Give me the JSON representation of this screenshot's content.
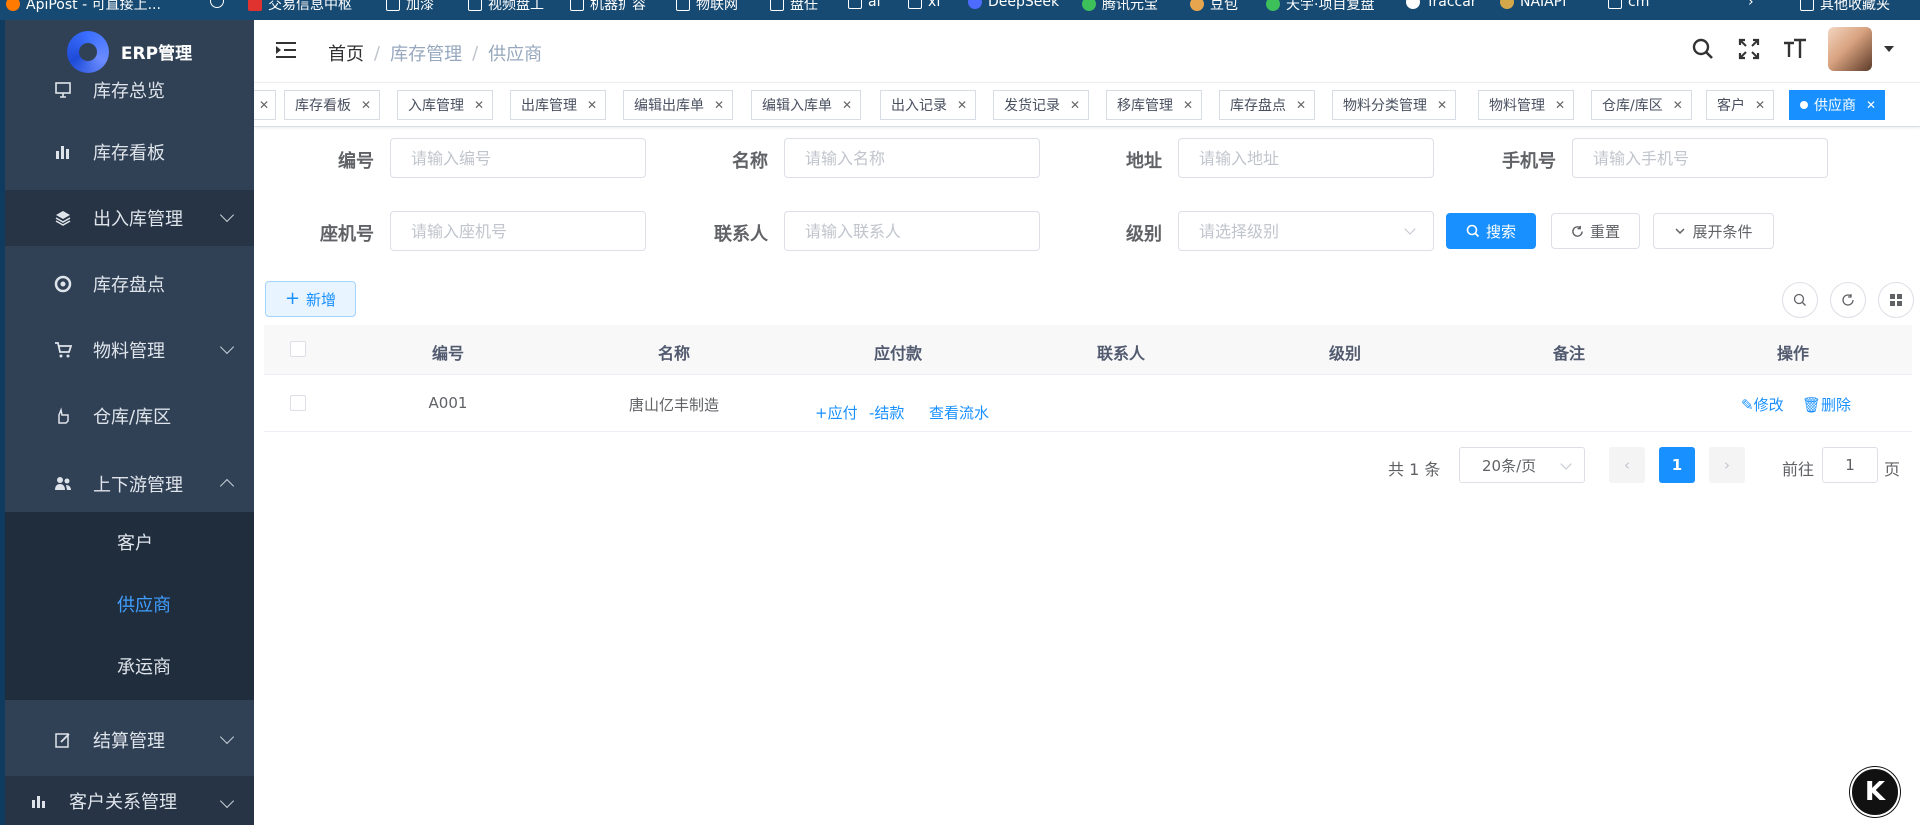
{
  "browser": {
    "bookmarks": [
      {
        "label": "ApiPost - 可直接上...",
        "color": "#ff7a00"
      },
      {
        "label": "",
        "color": "#ffffff"
      },
      {
        "label": "交易信息中枢",
        "color": "#e0322f"
      },
      {
        "label": "加漆",
        "color": "#ffffff"
      },
      {
        "label": "视频盘工",
        "color": "#ffffff"
      },
      {
        "label": "机器扩容",
        "color": "#ffffff"
      },
      {
        "label": "物联网",
        "color": "#ffffff"
      },
      {
        "label": "盘任",
        "color": "#ffffff"
      },
      {
        "label": "ai",
        "color": "#ffffff"
      },
      {
        "label": "xf",
        "color": "#ffffff"
      },
      {
        "label": "DeepSeek",
        "color": "#4d6bfe"
      },
      {
        "label": "腾讯元宝",
        "color": "#3dbf5a"
      },
      {
        "label": "豆包",
        "color": "#e7a64e"
      },
      {
        "label": "天宇·项目复盘",
        "color": "#3dbf5a"
      },
      {
        "label": "Traccar",
        "color": "#ffffff"
      },
      {
        "label": "NAIAPI",
        "color": "#d4a84a"
      },
      {
        "label": "cm",
        "color": "#ffffff"
      },
      {
        "label": "其他收藏夹",
        "color": "#ffffff"
      }
    ]
  },
  "sidebar": {
    "logo_text": "ERP管理",
    "items": [
      {
        "label": "库存总览",
        "icon": "monitor-icon"
      },
      {
        "label": "库存看板",
        "icon": "bar-chart-icon"
      },
      {
        "label": "出入库管理",
        "icon": "layers-icon"
      },
      {
        "label": "库存盘点",
        "icon": "aperture-icon"
      },
      {
        "label": "物料管理",
        "icon": "cart-icon"
      },
      {
        "label": "仓库/库区",
        "icon": "hand-icon"
      },
      {
        "label": "上下游管理",
        "icon": "users-icon"
      },
      {
        "label": "结算管理",
        "icon": "edit-icon"
      },
      {
        "label": "客户关系管理",
        "icon": "chart-icon"
      }
    ],
    "sub_items": [
      {
        "label": "客户"
      },
      {
        "label": "供应商"
      },
      {
        "label": "承运商"
      }
    ]
  },
  "navbar": {
    "breadcrumb": [
      "首页",
      "库存管理",
      "供应商"
    ],
    "separator": "/"
  },
  "tags": [
    {
      "label": ""
    },
    {
      "label": "库存看板"
    },
    {
      "label": "入库管理"
    },
    {
      "label": "出库管理"
    },
    {
      "label": "编辑出库单"
    },
    {
      "label": "编辑入库单"
    },
    {
      "label": "出入记录"
    },
    {
      "label": "发货记录"
    },
    {
      "label": "移库管理"
    },
    {
      "label": "库存盘点"
    },
    {
      "label": "物料分类管理"
    },
    {
      "label": "物料管理"
    },
    {
      "label": "仓库/库区"
    },
    {
      "label": "客户"
    },
    {
      "label": "供应商"
    }
  ],
  "search": {
    "code_label": "编号",
    "code_placeholder": "请输入编号",
    "name_label": "名称",
    "name_placeholder": "请输入名称",
    "address_label": "地址",
    "address_placeholder": "请输入地址",
    "mobile_label": "手机号",
    "mobile_placeholder": "请输入手机号",
    "phone_label": "座机号",
    "phone_placeholder": "请输入座机号",
    "contact_label": "联系人",
    "contact_placeholder": "请输入联系人",
    "level_label": "级别",
    "level_placeholder": "请选择级别",
    "search_btn": "搜索",
    "reset_btn": "重置",
    "expand_btn": "展开条件"
  },
  "toolbar": {
    "add_btn": "新增"
  },
  "table": {
    "columns": [
      "编号",
      "名称",
      "应付款",
      "联系人",
      "级别",
      "备注",
      "操作"
    ],
    "rows": [
      {
        "code": "A001",
        "name": "唐山亿丰制造",
        "payable_actions": [
          "+应付",
          "-结款",
          "查看流水"
        ],
        "contact": "",
        "level": "",
        "remark": "",
        "edit": "修改",
        "delete": "删除"
      }
    ]
  },
  "pagination": {
    "total": "共 1 条",
    "page_size": "20条/页",
    "current_page": "1",
    "goto_prefix": "前往",
    "goto_value": "1",
    "goto_suffix": "页"
  },
  "floating": {
    "label": "K"
  },
  "colors": {
    "primary": "#1890ff",
    "sidebar": "#304156",
    "submenu": "#1f2d3d"
  }
}
